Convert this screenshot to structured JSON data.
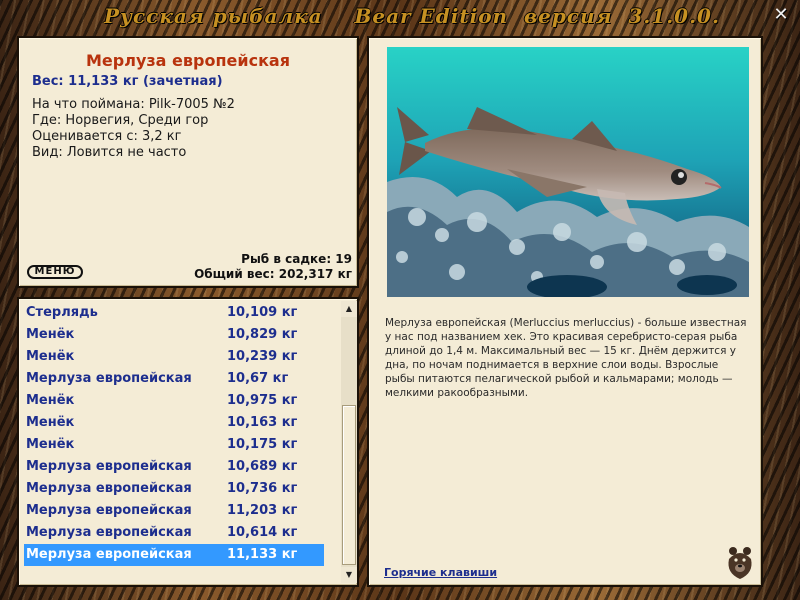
{
  "window": {
    "title": "Русская рыбалка    Bear Edition  версия  3.1.0.0.",
    "close_glyph": "✕"
  },
  "info": {
    "fish_name": "Мерлуза европейская",
    "weight_line": "Вес: 11,133 кг (зачетная)",
    "caught_with": "На что поймана: Pilk-7005 №2",
    "location": "Где: Норвегия, Среди гор",
    "value": "Оценивается с: 3,2 кг",
    "rarity": "Вид: Ловится не часто",
    "fish_in_keepnet": "Рыб в садке: 19",
    "total_weight": "Общий вес: 202,317 кг",
    "menu_button": "МЕНЮ"
  },
  "catch_list": [
    {
      "name": "Стерлядь",
      "weight": "10,109 кг"
    },
    {
      "name": "Менёк",
      "weight": "10,829 кг"
    },
    {
      "name": "Менёк",
      "weight": "10,239 кг"
    },
    {
      "name": "Мерлуза европейская",
      "weight": "10,67 кг"
    },
    {
      "name": "Менёк",
      "weight": "10,975 кг"
    },
    {
      "name": "Менёк",
      "weight": "10,163 кг"
    },
    {
      "name": "Менёк",
      "weight": "10,175 кг"
    },
    {
      "name": "Мерлуза европейская",
      "weight": "10,689 кг"
    },
    {
      "name": "Мерлуза европейская",
      "weight": "10,736 кг"
    },
    {
      "name": "Мерлуза европейская",
      "weight": "11,203 кг"
    },
    {
      "name": "Мерлуза европейская",
      "weight": "10,614 кг"
    },
    {
      "name": "Мерлуза европейская",
      "weight": "11,133 кг"
    }
  ],
  "selected_index": 11,
  "description": {
    "text": "Мерлуза европейская  (Merluccius merluccius) - больше известная у нас под названием хек. Это красивая серебристо-серая рыба длиной до 1,4 м. Максимальный вес — 15 кг. Днём держится у дна, по ночам поднимается в верхние слои воды. Взрослые рыбы питаются пелагической рыбой и кальмарами; молодь — мелкими ракообразными.",
    "hotkeys_link": "Горячие клавиши"
  },
  "icons": {
    "close": "close-icon",
    "scroll_up": "scroll-up-icon",
    "scroll_down": "scroll-down-icon",
    "bear_logo": "bear-logo-icon"
  },
  "colors": {
    "fish_name": "#b8330e",
    "link_blue": "#1d2e8e",
    "selection": "#3399ff",
    "panel_bg": "#f4ecd6",
    "title_gold": "#c69022"
  }
}
